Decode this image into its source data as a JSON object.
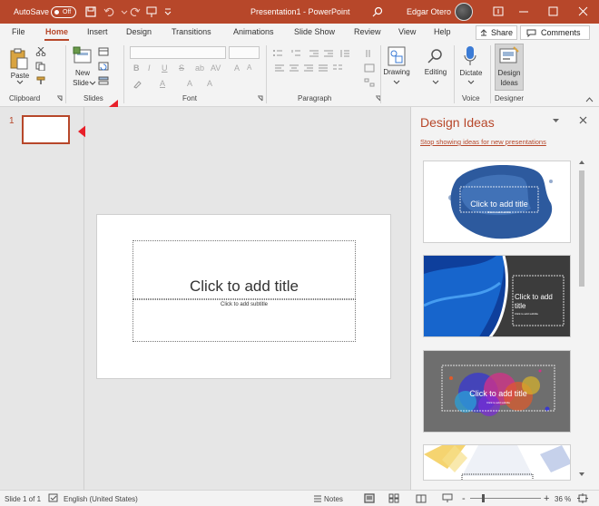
{
  "titlebar": {
    "autosave_label": "AutoSave",
    "autosave_state": "Off",
    "document_title": "Presentation1 - PowerPoint",
    "user_name": "Edgar Otero"
  },
  "ribbon_tabs": [
    "File",
    "Home",
    "Insert",
    "Design",
    "Transitions",
    "Animations",
    "Slide Show",
    "Review",
    "View",
    "Help"
  ],
  "active_tab": "Home",
  "actions": {
    "share": "Share",
    "comments": "Comments"
  },
  "ribbon": {
    "clipboard": {
      "paste": "Paste",
      "group": "Clipboard"
    },
    "slides": {
      "new_slide_line1": "New",
      "new_slide_line2": "Slide",
      "group": "Slides"
    },
    "font": {
      "group": "Font"
    },
    "paragraph": {
      "group": "Paragraph"
    },
    "drawing": {
      "label": "Drawing"
    },
    "editing": {
      "label": "Editing"
    },
    "voice": {
      "dictate": "Dictate",
      "group": "Voice"
    },
    "designer": {
      "label_line1": "Design",
      "label_line2": "Ideas",
      "group": "Designer"
    }
  },
  "slide_panel": {
    "number": "1"
  },
  "slide": {
    "title_placeholder": "Click to add title",
    "subtitle_placeholder": "Click to add subtitle"
  },
  "design_pane": {
    "title": "Design Ideas",
    "stop_link": "Stop showing ideas for new presentations",
    "ideas": [
      {
        "title": "Click to add title",
        "subtitle": "Click to add subtitle"
      },
      {
        "title": "Click to add title",
        "subtitle": "Click to add subtitle"
      },
      {
        "title": "Click to add title",
        "subtitle": "Click to add subtitle"
      }
    ]
  },
  "statusbar": {
    "slide_info": "Slide 1 of 1",
    "language": "English (United States)",
    "notes": "Notes",
    "zoom": "36 %"
  },
  "colors": {
    "accent": "#b7472a",
    "arrow": "#e8202a"
  }
}
